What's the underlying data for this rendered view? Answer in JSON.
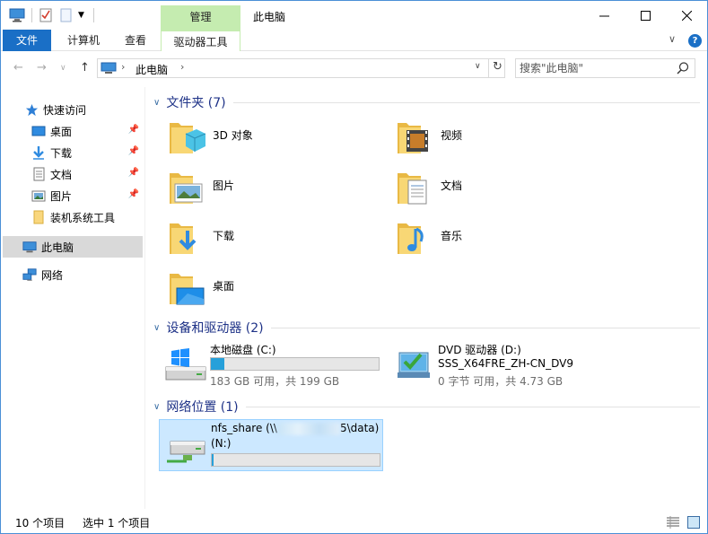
{
  "window": {
    "title": "此电脑",
    "manage_tab": "管理"
  },
  "ribbon": {
    "file": "文件",
    "computer": "计算机",
    "view": "查看",
    "drive_tools": "驱动器工具"
  },
  "address": {
    "path": "此电脑",
    "search_placeholder": "搜索\"此电脑\""
  },
  "sidebar": {
    "quick_access": "快速访问",
    "items": [
      {
        "label": "桌面",
        "icon": "desktop-icon",
        "pinned": true
      },
      {
        "label": "下载",
        "icon": "download-icon",
        "pinned": true
      },
      {
        "label": "文档",
        "icon": "document-icon",
        "pinned": true
      },
      {
        "label": "图片",
        "icon": "pictures-icon",
        "pinned": true
      },
      {
        "label": "装机系统工具",
        "icon": "folder-icon",
        "pinned": false
      }
    ],
    "this_pc": "此电脑",
    "network": "网络"
  },
  "groups": {
    "folders": "文件夹 (7)",
    "devices": "设备和驱动器 (2)",
    "network": "网络位置 (1)"
  },
  "folders": [
    {
      "label": "3D 对象",
      "icon": "3d-objects-icon"
    },
    {
      "label": "视频",
      "icon": "videos-icon"
    },
    {
      "label": "图片",
      "icon": "pictures-icon"
    },
    {
      "label": "文档",
      "icon": "documents-icon"
    },
    {
      "label": "下载",
      "icon": "downloads-icon"
    },
    {
      "label": "音乐",
      "icon": "music-icon"
    },
    {
      "label": "桌面",
      "icon": "desktop-icon"
    }
  ],
  "drives": {
    "local": {
      "name": "本地磁盘 (C:)",
      "status": "183 GB 可用，共 199 GB",
      "used_fraction": 0.08
    },
    "dvd": {
      "name": "DVD 驱动器 (D:)",
      "label": "SSS_X64FRE_ZH-CN_DV9",
      "status": "0 字节 可用，共 4.73 GB"
    },
    "nfs": {
      "name_prefix": "nfs_share (\\\\",
      "name_suffix": "5\\data)",
      "letter": "(N:)",
      "used_fraction": 0.01
    }
  },
  "status": {
    "count": "10 个项目",
    "selected": "选中 1 个项目"
  },
  "colors": {
    "accent": "#1a6fc6",
    "manage_tab": "#c5ecb0",
    "selection": "#cce8ff",
    "bar_fill": "#26a0da"
  }
}
